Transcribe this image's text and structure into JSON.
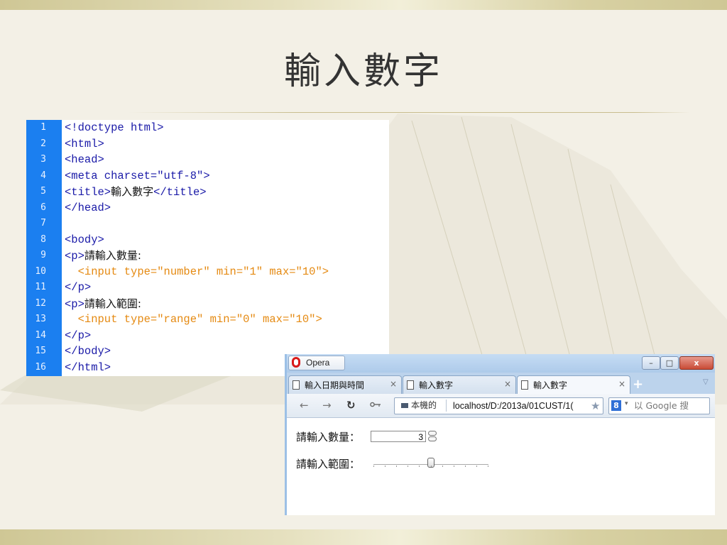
{
  "slide": {
    "title": "輸入數字"
  },
  "code_lines": [
    {
      "num": "1",
      "text": "<!doctype html>"
    },
    {
      "num": "2",
      "text": "<html>"
    },
    {
      "num": "3",
      "text": "<head>"
    },
    {
      "num": "4",
      "text": "<meta charset=\"utf-8\">"
    },
    {
      "num": "5",
      "pre": "<title>",
      "cjk": "輸入數字",
      "post": "</title>"
    },
    {
      "num": "6",
      "text": "</head>"
    },
    {
      "num": "7",
      "text": ""
    },
    {
      "num": "8",
      "text": "<body>"
    },
    {
      "num": "9",
      "pre": "<p>",
      "cjk": "請輸入數量:",
      "post": ""
    },
    {
      "num": "10",
      "text": "  <input type=\"number\" min=\"1\" max=\"10\">"
    },
    {
      "num": "11",
      "text": "</p>"
    },
    {
      "num": "12",
      "pre": "<p>",
      "cjk": "請輸入範圍:",
      "post": ""
    },
    {
      "num": "13",
      "text": "  <input type=\"range\" min=\"0\" max=\"10\">"
    },
    {
      "num": "14",
      "text": "</p>"
    },
    {
      "num": "15",
      "text": "</body>"
    },
    {
      "num": "16",
      "text": "</html>"
    }
  ],
  "browser": {
    "app_name": "Opera",
    "window_buttons": {
      "minimize": "–",
      "maximize": "□",
      "close": "x"
    },
    "tabs": [
      {
        "label": "輸入日期與時間",
        "close": "×"
      },
      {
        "label": "輸入數字",
        "close": "×"
      },
      {
        "label": "輸入數字",
        "close": "×",
        "active": true
      }
    ],
    "new_tab": "+",
    "tab_menu": "▽",
    "nav": {
      "back": "←",
      "forward": "→",
      "reload": "↻"
    },
    "address": {
      "badge": "本機的",
      "url": "localhost/D:/2013a/01CUST/1("
    },
    "search": {
      "engine": "8",
      "caret": "▾",
      "placeholder": "以 Google 搜"
    }
  },
  "page": {
    "number_label": "請輸入數量：",
    "number_value": "3",
    "range_label": "請輸入範圍：",
    "range_min": 0,
    "range_max": 10,
    "range_value": 5
  }
}
